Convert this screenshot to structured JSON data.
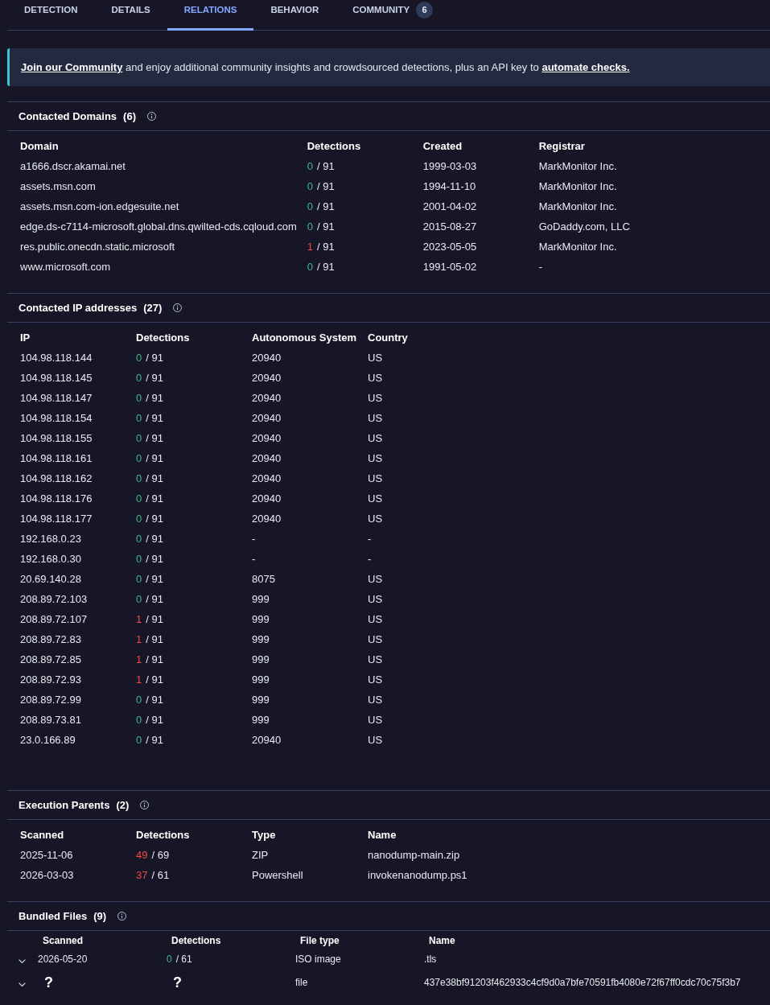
{
  "tabs": [
    {
      "label": "DETECTION",
      "selected": false
    },
    {
      "label": "DETAILS",
      "selected": false
    },
    {
      "label": "RELATIONS",
      "selected": true
    },
    {
      "label": "BEHAVIOR",
      "selected": false
    },
    {
      "label": "COMMUNITY",
      "selected": false,
      "badge": "6"
    }
  ],
  "banner": {
    "parts": [
      {
        "kind": "link",
        "text": "Join our Community"
      },
      {
        "kind": "text",
        "text": " and enjoy additional community insights and crowdsourced detections, plus an API key to "
      },
      {
        "kind": "link",
        "text": "automate checks."
      }
    ]
  },
  "sections": [
    {
      "title": "Contacted Domains",
      "count": "(6)",
      "expandable": false,
      "columns": [
        "Domain",
        "Detections",
        "Created",
        "Registrar"
      ],
      "rows": [
        [
          "a1666.dscr.akamai.net",
          {
            "kind": "detections",
            "hits": "0",
            "total": "/ 91",
            "flagged": false
          },
          "1999-03-03",
          "MarkMonitor Inc."
        ],
        [
          "assets.msn.com",
          {
            "kind": "detections",
            "hits": "0",
            "total": "/ 91",
            "flagged": false
          },
          "1994-11-10",
          "MarkMonitor Inc."
        ],
        [
          "assets.msn.com-ion.edgesuite.net",
          {
            "kind": "detections",
            "hits": "0",
            "total": "/ 91",
            "flagged": false
          },
          "2001-04-02",
          "MarkMonitor Inc."
        ],
        [
          "edge.ds-c7114-microsoft.global.dns.qwilted-cds.cqloud.com",
          {
            "kind": "detections",
            "hits": "0",
            "total": "/ 91",
            "flagged": false
          },
          "2015-08-27",
          "GoDaddy.com, LLC"
        ],
        [
          "res.public.onecdn.static.microsoft",
          {
            "kind": "detections",
            "hits": "1",
            "total": "/ 91",
            "flagged": true
          },
          "2023-05-05",
          "MarkMonitor Inc."
        ],
        [
          "www.microsoft.com",
          {
            "kind": "detections",
            "hits": "0",
            "total": "/ 91",
            "flagged": false
          },
          "1991-05-02",
          "-"
        ]
      ]
    },
    {
      "title": "Contacted IP addresses",
      "count": "(27)",
      "expandable": false,
      "columns": [
        "IP",
        "Detections",
        "Autonomous System",
        "Country"
      ],
      "rows": [
        [
          "104.98.118.144",
          {
            "kind": "detections",
            "hits": "0",
            "total": "/ 91",
            "flagged": false
          },
          "20940",
          "US"
        ],
        [
          "104.98.118.145",
          {
            "kind": "detections",
            "hits": "0",
            "total": "/ 91",
            "flagged": false
          },
          "20940",
          "US"
        ],
        [
          "104.98.118.147",
          {
            "kind": "detections",
            "hits": "0",
            "total": "/ 91",
            "flagged": false
          },
          "20940",
          "US"
        ],
        [
          "104.98.118.154",
          {
            "kind": "detections",
            "hits": "0",
            "total": "/ 91",
            "flagged": false
          },
          "20940",
          "US"
        ],
        [
          "104.98.118.155",
          {
            "kind": "detections",
            "hits": "0",
            "total": "/ 91",
            "flagged": false
          },
          "20940",
          "US"
        ],
        [
          "104.98.118.161",
          {
            "kind": "detections",
            "hits": "0",
            "total": "/ 91",
            "flagged": false
          },
          "20940",
          "US"
        ],
        [
          "104.98.118.162",
          {
            "kind": "detections",
            "hits": "0",
            "total": "/ 91",
            "flagged": false
          },
          "20940",
          "US"
        ],
        [
          "104.98.118.176",
          {
            "kind": "detections",
            "hits": "0",
            "total": "/ 91",
            "flagged": false
          },
          "20940",
          "US"
        ],
        [
          "104.98.118.177",
          {
            "kind": "detections",
            "hits": "0",
            "total": "/ 91",
            "flagged": false
          },
          "20940",
          "US"
        ],
        [
          "192.168.0.23",
          {
            "kind": "detections",
            "hits": "0",
            "total": "/ 91",
            "flagged": false
          },
          "-",
          "-"
        ],
        [
          "192.168.0.30",
          {
            "kind": "detections",
            "hits": "0",
            "total": "/ 91",
            "flagged": false
          },
          "-",
          "-"
        ],
        [
          "20.69.140.28",
          {
            "kind": "detections",
            "hits": "0",
            "total": "/ 91",
            "flagged": false
          },
          "8075",
          "US"
        ],
        [
          "208.89.72.103",
          {
            "kind": "detections",
            "hits": "0",
            "total": "/ 91",
            "flagged": false
          },
          "999",
          "US"
        ],
        [
          "208.89.72.107",
          {
            "kind": "detections",
            "hits": "1",
            "total": "/ 91",
            "flagged": true
          },
          "999",
          "US"
        ],
        [
          "208.89.72.83",
          {
            "kind": "detections",
            "hits": "1",
            "total": "/ 91",
            "flagged": true
          },
          "999",
          "US"
        ],
        [
          "208.89.72.85",
          {
            "kind": "detections",
            "hits": "1",
            "total": "/ 91",
            "flagged": true
          },
          "999",
          "US"
        ],
        [
          "208.89.72.93",
          {
            "kind": "detections",
            "hits": "1",
            "total": "/ 91",
            "flagged": true
          },
          "999",
          "US"
        ],
        [
          "208.89.72.99",
          {
            "kind": "detections",
            "hits": "0",
            "total": "/ 91",
            "flagged": false
          },
          "999",
          "US"
        ],
        [
          "208.89.73.81",
          {
            "kind": "detections",
            "hits": "0",
            "total": "/ 91",
            "flagged": false
          },
          "999",
          "US"
        ],
        [
          "23.0.166.89",
          {
            "kind": "detections",
            "hits": "0",
            "total": "/ 91",
            "flagged": false
          },
          "20940",
          "US"
        ]
      ]
    },
    {
      "title": "Execution Parents",
      "count": "(2)",
      "expandable": false,
      "columns": [
        "Scanned",
        "Detections",
        "Type",
        "Name"
      ],
      "rows": [
        [
          "2025-11-06",
          {
            "kind": "detections",
            "hits": "49",
            "total": "/ 69",
            "flagged": true
          },
          "ZIP",
          "nanodump-main.zip"
        ],
        [
          "2026-03-03",
          {
            "kind": "detections",
            "hits": "37",
            "total": "/ 61",
            "flagged": true
          },
          "Powershell",
          "invokenanodump.ps1"
        ]
      ]
    },
    {
      "title": "Bundled Files",
      "count": "(9)",
      "expandable": true,
      "columns": [
        "Scanned",
        "Detections",
        "File type",
        "Name"
      ],
      "rows": [
        [
          "2026-05-20",
          {
            "kind": "detections",
            "hits": "0",
            "total": "/ 61",
            "flagged": false
          },
          "ISO image",
          ".tls"
        ],
        [
          {
            "kind": "unknown",
            "text": "?"
          },
          {
            "kind": "unknown",
            "text": "?"
          },
          "file",
          "437e38bf91203f462933c4cf9d0a7bfe70591fb4080e72f67ff0cdc70c75f3b7"
        ]
      ]
    }
  ]
}
